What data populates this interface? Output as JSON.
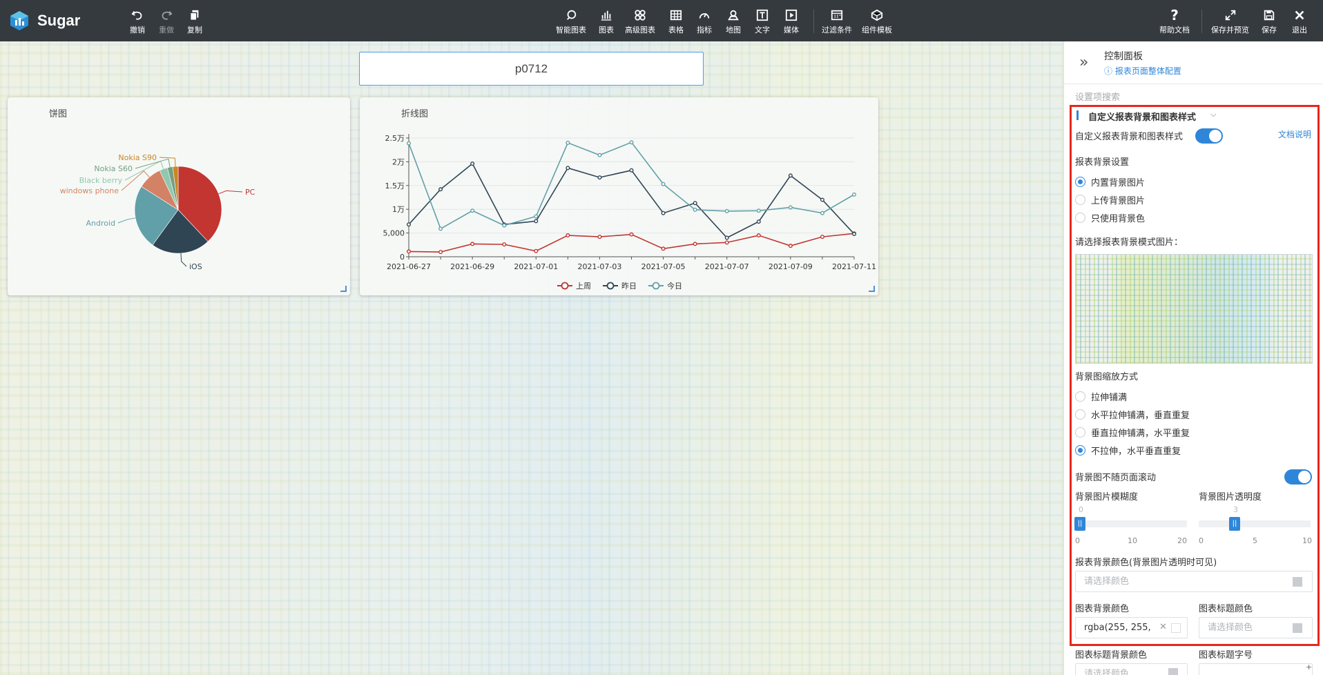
{
  "app": {
    "name": "Sugar"
  },
  "toolbar": {
    "left": [
      {
        "label": "撤销",
        "icon": "undo-icon"
      },
      {
        "label": "重做",
        "icon": "redo-icon"
      },
      {
        "label": "复制",
        "icon": "copy-icon"
      }
    ],
    "center": [
      {
        "label": "智能图表",
        "icon": "smart-chart-icon"
      },
      {
        "label": "图表",
        "icon": "chart-icon"
      },
      {
        "label": "高级图表",
        "icon": "advanced-chart-icon"
      },
      {
        "label": "表格",
        "icon": "table-icon"
      },
      {
        "label": "指标",
        "icon": "gauge-icon"
      },
      {
        "label": "地图",
        "icon": "map-icon"
      },
      {
        "label": "文字",
        "icon": "text-icon"
      },
      {
        "label": "媒体",
        "icon": "media-icon"
      },
      {
        "label": "过滤条件",
        "icon": "filter-icon"
      },
      {
        "label": "组件模板",
        "icon": "template-icon"
      }
    ],
    "right": [
      {
        "label": "帮助文档",
        "icon": "help-icon"
      },
      {
        "label": "保存并预览",
        "icon": "expand-icon"
      },
      {
        "label": "保存",
        "icon": "save-icon"
      },
      {
        "label": "退出",
        "icon": "close-icon"
      }
    ]
  },
  "report": {
    "title": "p0712"
  },
  "pie_panel": {
    "title": "饼图"
  },
  "line_panel": {
    "title": "折线图"
  },
  "chart_data": [
    {
      "type": "pie",
      "title": "饼图",
      "categories": [
        "PC",
        "iOS",
        "Android",
        "windows phone",
        "Black berry",
        "Nokia S60",
        "Nokia S90"
      ],
      "values": [
        38,
        22,
        24,
        9,
        3,
        2,
        2
      ],
      "colors": [
        "#c23531",
        "#2f4554",
        "#61a0a8",
        "#d48265",
        "#91c7ae",
        "#749f83",
        "#ca8622"
      ]
    },
    {
      "type": "line",
      "title": "折线图",
      "categories": [
        "2021-06-27",
        "2021-06-28",
        "2021-06-29",
        "2021-06-30",
        "2021-07-01",
        "2021-07-02",
        "2021-07-03",
        "2021-07-04",
        "2021-07-05",
        "2021-07-06",
        "2021-07-07",
        "2021-07-08",
        "2021-07-09",
        "2021-07-10",
        "2021-07-11"
      ],
      "x_tick_labels": [
        "2021-06-27",
        "2021-06-29",
        "2021-07-01",
        "2021-07-03",
        "2021-07-05",
        "2021-07-07",
        "2021-07-09",
        "2021-07-11"
      ],
      "y_tick_labels": [
        "0",
        "5,000",
        "1万",
        "1.5万",
        "2万",
        "2.5万"
      ],
      "ylim": [
        0,
        25000
      ],
      "series": [
        {
          "name": "上周",
          "color": "#c23531",
          "values": [
            1100,
            1000,
            2700,
            2600,
            1200,
            4500,
            4200,
            4700,
            1700,
            2700,
            3000,
            4500,
            2300,
            4200,
            4900
          ]
        },
        {
          "name": "昨日",
          "color": "#2f4554",
          "values": [
            6800,
            14200,
            19600,
            6800,
            7500,
            18700,
            16700,
            18200,
            9200,
            11300,
            4000,
            7400,
            17100,
            12000,
            4800
          ]
        },
        {
          "name": "今日",
          "color": "#61a0a8",
          "values": [
            23900,
            5900,
            9700,
            6600,
            8500,
            24000,
            21400,
            24100,
            15300,
            9900,
            9600,
            9700,
            10400,
            9200,
            13100
          ]
        }
      ],
      "legend": "bottom"
    }
  ],
  "side_panel": {
    "title": "控制面板",
    "subtitle": "报表页面整体配置",
    "search_placeholder": "设置项搜索",
    "section_title": "自定义报表背景和图表样式",
    "custom_toggle_label": "自定义报表背景和图表样式",
    "doc_link": "文档说明",
    "bg_settings_label": "报表背景设置",
    "bg_options": [
      "内置背景图片",
      "上传背景图片",
      "只使用背景色"
    ],
    "bg_selected": 0,
    "choose_pattern_label": "请选择报表背景模式图片：",
    "scale_label": "背景图缩放方式",
    "scale_options": [
      "拉伸铺满",
      "水平拉伸铺满，垂直重复",
      "垂直拉伸铺满，水平重复",
      "不拉伸，水平垂直重复"
    ],
    "scale_selected": 3,
    "fixed_scroll_label": "背景图不随页面滚动",
    "blur_label": "背景图片模糊度",
    "blur_value": "0",
    "blur_ticks": [
      "0",
      "10",
      "20"
    ],
    "opacity_label": "背景图片透明度",
    "opacity_value": "3",
    "opacity_ticks": [
      "0",
      "5",
      "10"
    ],
    "report_bg_color_label": "报表背景颜色(背景图片透明时可见)",
    "color_placeholder": "请选择颜色",
    "chart_bg_color_label": "图表背景颜色",
    "chart_bg_color_value": "rgba(255, 255,",
    "chart_title_color_label": "图表标题颜色",
    "chart_title_bg_label": "图表标题背景颜色",
    "chart_title_font_label": "图表标题字号"
  }
}
